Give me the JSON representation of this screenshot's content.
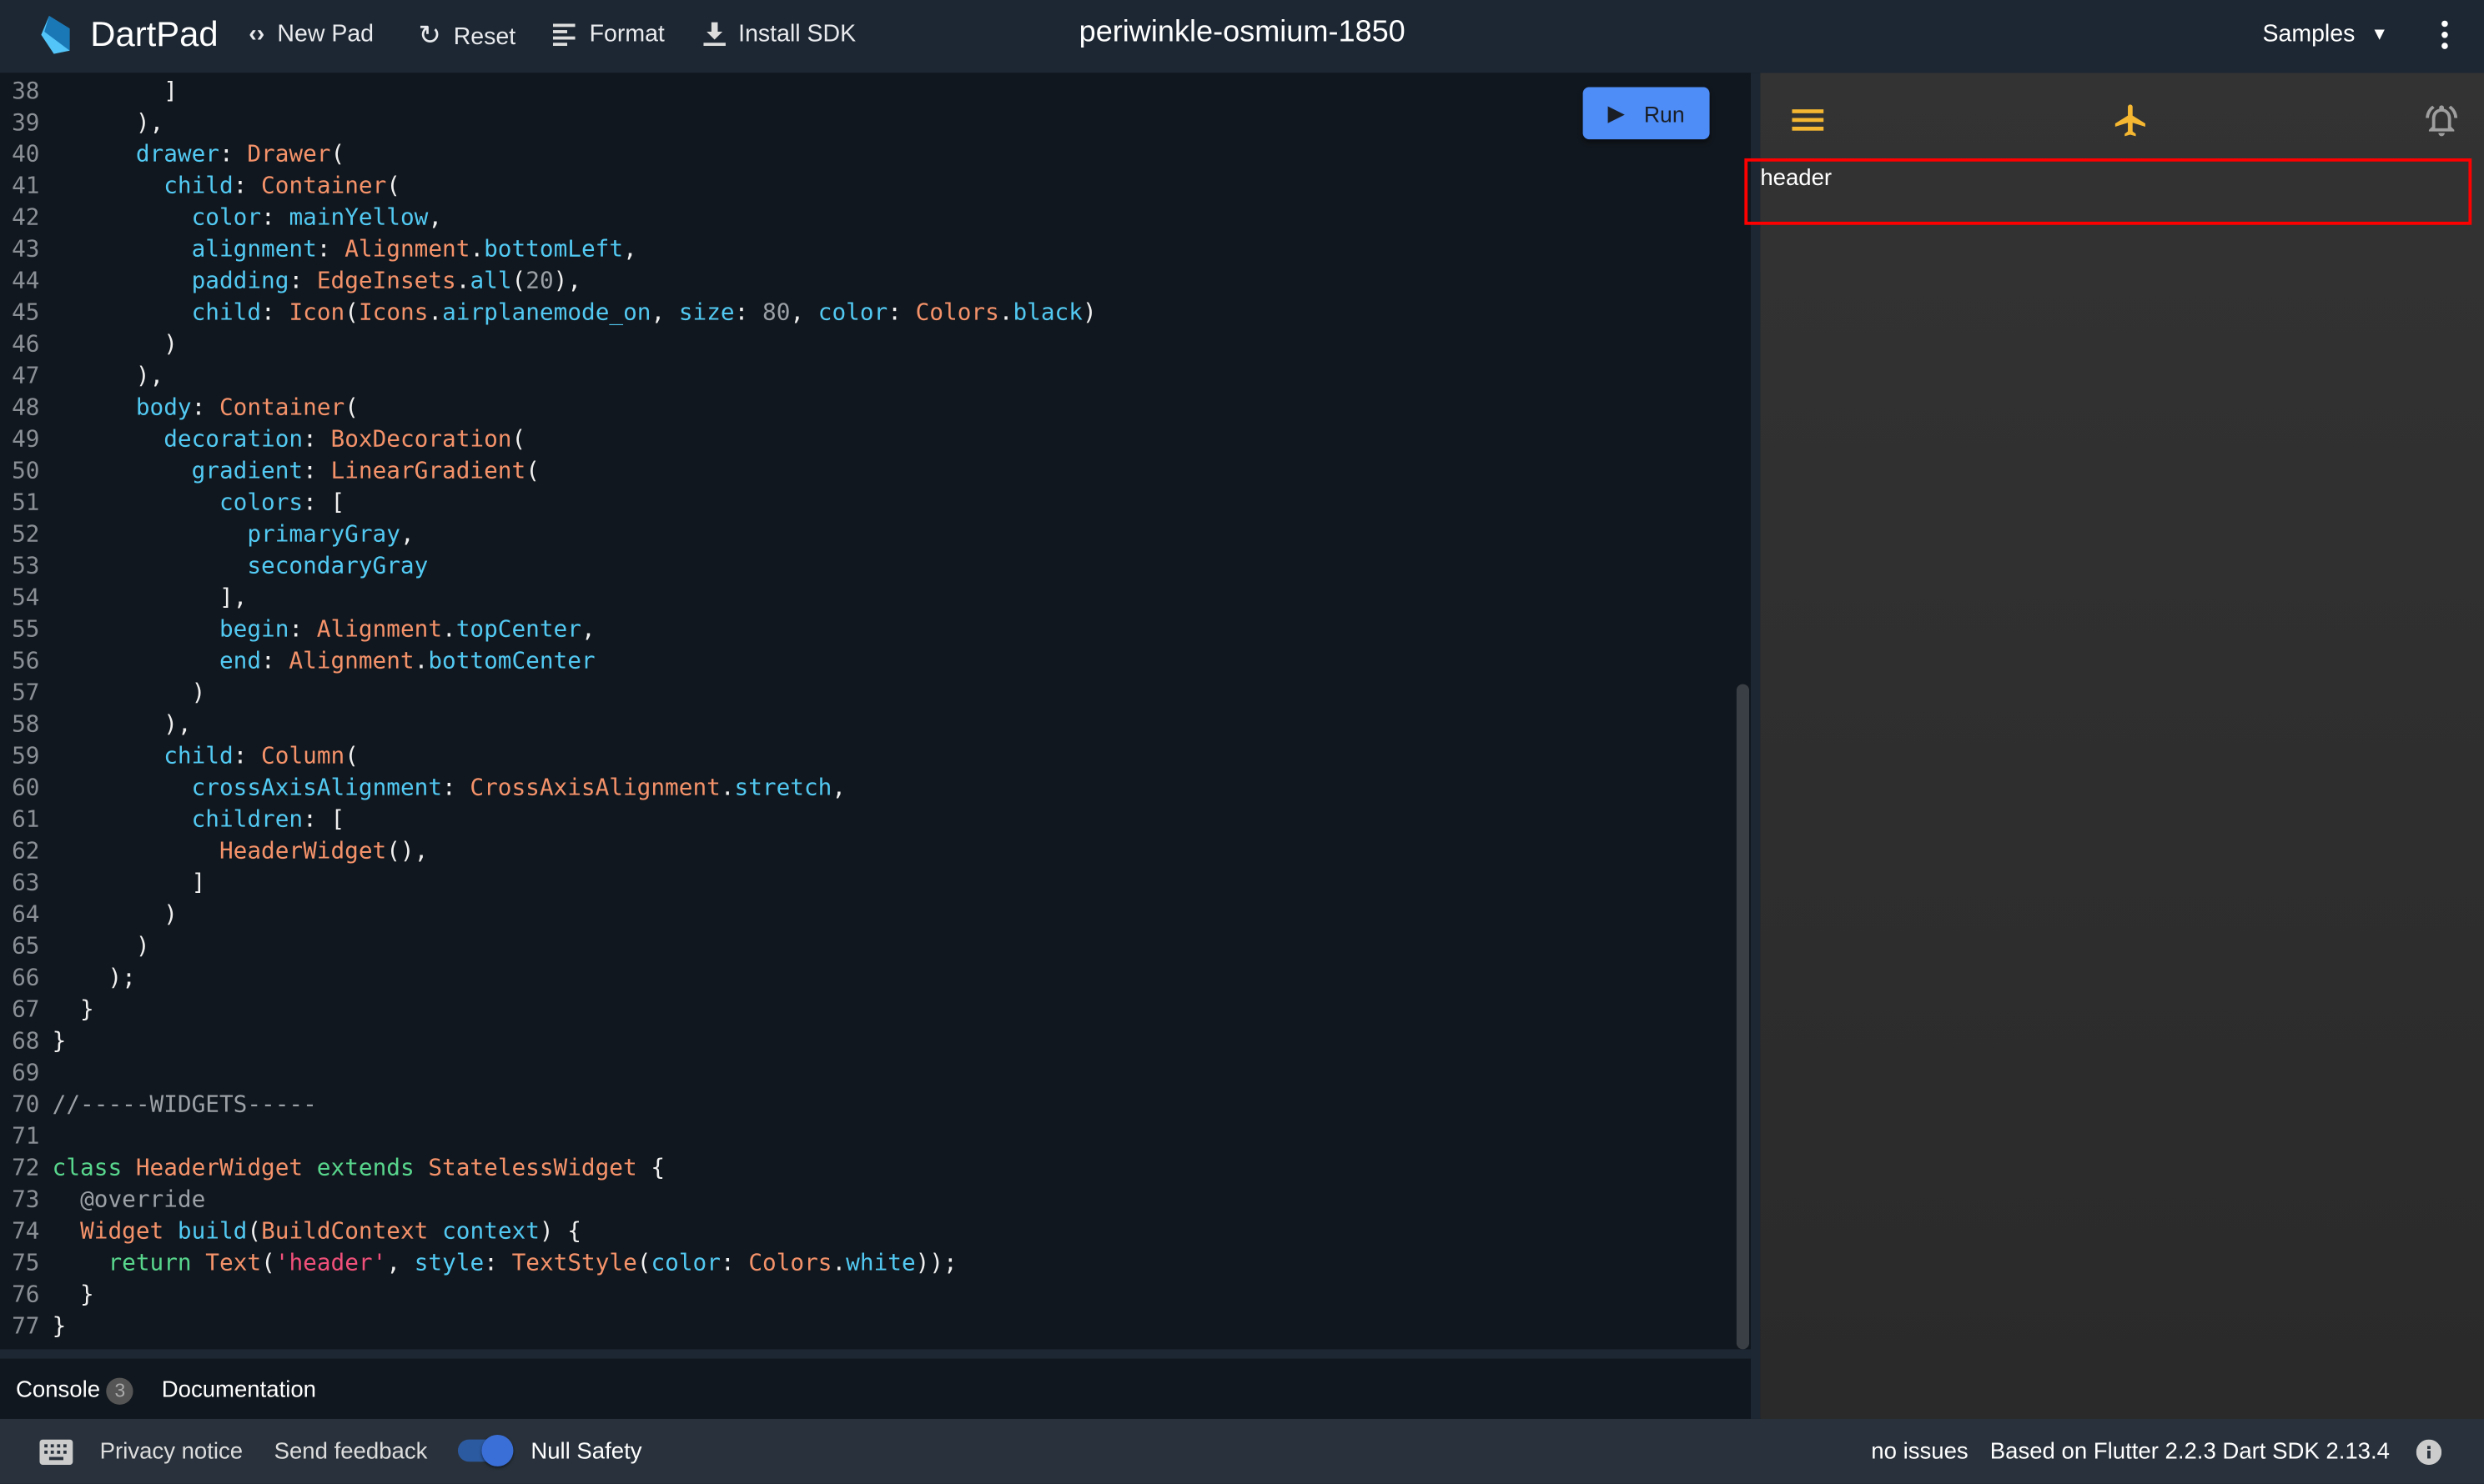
{
  "header": {
    "brand": "DartPad",
    "new_pad": "New Pad",
    "reset": "Reset",
    "format": "Format",
    "install_sdk": "Install SDK",
    "title": "periwinkle-osmium-1850",
    "samples": "Samples"
  },
  "editor": {
    "run_label": "Run",
    "first_line": 38,
    "lines": [
      [
        [
          "x",
          "        ]"
        ]
      ],
      [
        [
          "x",
          "      ),"
        ]
      ],
      [
        [
          "x",
          "      "
        ],
        [
          "p",
          "drawer"
        ],
        [
          "x",
          ": "
        ],
        [
          "t",
          "Drawer"
        ],
        [
          "x",
          "("
        ]
      ],
      [
        [
          "x",
          "        "
        ],
        [
          "p",
          "child"
        ],
        [
          "x",
          ": "
        ],
        [
          "t",
          "Container"
        ],
        [
          "x",
          "("
        ]
      ],
      [
        [
          "x",
          "          "
        ],
        [
          "p",
          "color"
        ],
        [
          "x",
          ": "
        ],
        [
          "p",
          "mainYellow"
        ],
        [
          "x",
          ","
        ]
      ],
      [
        [
          "x",
          "          "
        ],
        [
          "p",
          "alignment"
        ],
        [
          "x",
          ": "
        ],
        [
          "t",
          "Alignment"
        ],
        [
          "x",
          "."
        ],
        [
          "p",
          "bottomLeft"
        ],
        [
          "x",
          ","
        ]
      ],
      [
        [
          "x",
          "          "
        ],
        [
          "p",
          "padding"
        ],
        [
          "x",
          ": "
        ],
        [
          "t",
          "EdgeInsets"
        ],
        [
          "x",
          "."
        ],
        [
          "p",
          "all"
        ],
        [
          "x",
          "("
        ],
        [
          "n",
          "20"
        ],
        [
          "x",
          "),"
        ]
      ],
      [
        [
          "x",
          "          "
        ],
        [
          "p",
          "child"
        ],
        [
          "x",
          ": "
        ],
        [
          "t",
          "Icon"
        ],
        [
          "x",
          "("
        ],
        [
          "t",
          "Icons"
        ],
        [
          "x",
          "."
        ],
        [
          "p",
          "airplanemode_on"
        ],
        [
          "x",
          ", "
        ],
        [
          "p",
          "size"
        ],
        [
          "x",
          ": "
        ],
        [
          "n",
          "80"
        ],
        [
          "x",
          ", "
        ],
        [
          "p",
          "color"
        ],
        [
          "x",
          ": "
        ],
        [
          "t",
          "Colors"
        ],
        [
          "x",
          "."
        ],
        [
          "p",
          "black"
        ],
        [
          "x",
          ")"
        ]
      ],
      [
        [
          "x",
          "        )"
        ]
      ],
      [
        [
          "x",
          "      ),"
        ]
      ],
      [
        [
          "x",
          "      "
        ],
        [
          "p",
          "body"
        ],
        [
          "x",
          ": "
        ],
        [
          "t",
          "Container"
        ],
        [
          "x",
          "("
        ]
      ],
      [
        [
          "x",
          "        "
        ],
        [
          "p",
          "decoration"
        ],
        [
          "x",
          ": "
        ],
        [
          "t",
          "BoxDecoration"
        ],
        [
          "x",
          "("
        ]
      ],
      [
        [
          "x",
          "          "
        ],
        [
          "p",
          "gradient"
        ],
        [
          "x",
          ": "
        ],
        [
          "t",
          "LinearGradient"
        ],
        [
          "x",
          "("
        ]
      ],
      [
        [
          "x",
          "            "
        ],
        [
          "p",
          "colors"
        ],
        [
          "x",
          ": ["
        ]
      ],
      [
        [
          "x",
          "              "
        ],
        [
          "p",
          "primaryGray"
        ],
        [
          "x",
          ","
        ]
      ],
      [
        [
          "x",
          "              "
        ],
        [
          "p",
          "secondaryGray"
        ]
      ],
      [
        [
          "x",
          "            ],"
        ]
      ],
      [
        [
          "x",
          "            "
        ],
        [
          "p",
          "begin"
        ],
        [
          "x",
          ": "
        ],
        [
          "t",
          "Alignment"
        ],
        [
          "x",
          "."
        ],
        [
          "p",
          "topCenter"
        ],
        [
          "x",
          ","
        ]
      ],
      [
        [
          "x",
          "            "
        ],
        [
          "p",
          "end"
        ],
        [
          "x",
          ": "
        ],
        [
          "t",
          "Alignment"
        ],
        [
          "x",
          "."
        ],
        [
          "p",
          "bottomCenter"
        ]
      ],
      [
        [
          "x",
          "          )"
        ]
      ],
      [
        [
          "x",
          "        ),"
        ]
      ],
      [
        [
          "x",
          "        "
        ],
        [
          "p",
          "child"
        ],
        [
          "x",
          ": "
        ],
        [
          "t",
          "Column"
        ],
        [
          "x",
          "("
        ]
      ],
      [
        [
          "x",
          "          "
        ],
        [
          "p",
          "crossAxisAlignment"
        ],
        [
          "x",
          ": "
        ],
        [
          "t",
          "CrossAxisAlignment"
        ],
        [
          "x",
          "."
        ],
        [
          "p",
          "stretch"
        ],
        [
          "x",
          ","
        ]
      ],
      [
        [
          "x",
          "          "
        ],
        [
          "p",
          "children"
        ],
        [
          "x",
          ": ["
        ]
      ],
      [
        [
          "x",
          "            "
        ],
        [
          "t",
          "HeaderWidget"
        ],
        [
          "x",
          "(),"
        ]
      ],
      [
        [
          "x",
          "          ]"
        ]
      ],
      [
        [
          "x",
          "        )"
        ]
      ],
      [
        [
          "x",
          "      )"
        ]
      ],
      [
        [
          "x",
          "    );"
        ]
      ],
      [
        [
          "x",
          "  }"
        ]
      ],
      [
        [
          "x",
          "}"
        ]
      ],
      [],
      [
        [
          "c",
          "//-----WIDGETS-----"
        ]
      ],
      [],
      [
        [
          "k",
          "class "
        ],
        [
          "t",
          "HeaderWidget "
        ],
        [
          "k",
          "extends "
        ],
        [
          "t",
          "StatelessWidget "
        ],
        [
          "x",
          "{"
        ]
      ],
      [
        [
          "x",
          "  "
        ],
        [
          "c",
          "@override"
        ]
      ],
      [
        [
          "x",
          "  "
        ],
        [
          "t",
          "Widget "
        ],
        [
          "p",
          "build"
        ],
        [
          "x",
          "("
        ],
        [
          "t",
          "BuildContext "
        ],
        [
          "p",
          "context"
        ],
        [
          "x",
          ") {"
        ]
      ],
      [
        [
          "x",
          "    "
        ],
        [
          "k",
          "return "
        ],
        [
          "t",
          "Text"
        ],
        [
          "x",
          "("
        ],
        [
          "s",
          "'header'"
        ],
        [
          "x",
          ", "
        ],
        [
          "p",
          "style"
        ],
        [
          "x",
          ": "
        ],
        [
          "t",
          "TextStyle"
        ],
        [
          "x",
          "("
        ],
        [
          "p",
          "color"
        ],
        [
          "x",
          ": "
        ],
        [
          "t",
          "Colors"
        ],
        [
          "x",
          "."
        ],
        [
          "p",
          "white"
        ],
        [
          "x",
          "));"
        ]
      ],
      [
        [
          "x",
          "  }"
        ]
      ],
      [
        [
          "x",
          "}"
        ]
      ]
    ]
  },
  "output": {
    "header_text": "header",
    "accent": "#f5b731"
  },
  "console": {
    "console_label": "Console",
    "console_count": "3",
    "documentation_label": "Documentation"
  },
  "footer": {
    "privacy": "Privacy notice",
    "feedback": "Send feedback",
    "null_safety": "Null Safety",
    "null_safety_on": true,
    "issues": "no issues",
    "sdk": "Based on Flutter 2.2.3 Dart SDK 2.13.4"
  }
}
